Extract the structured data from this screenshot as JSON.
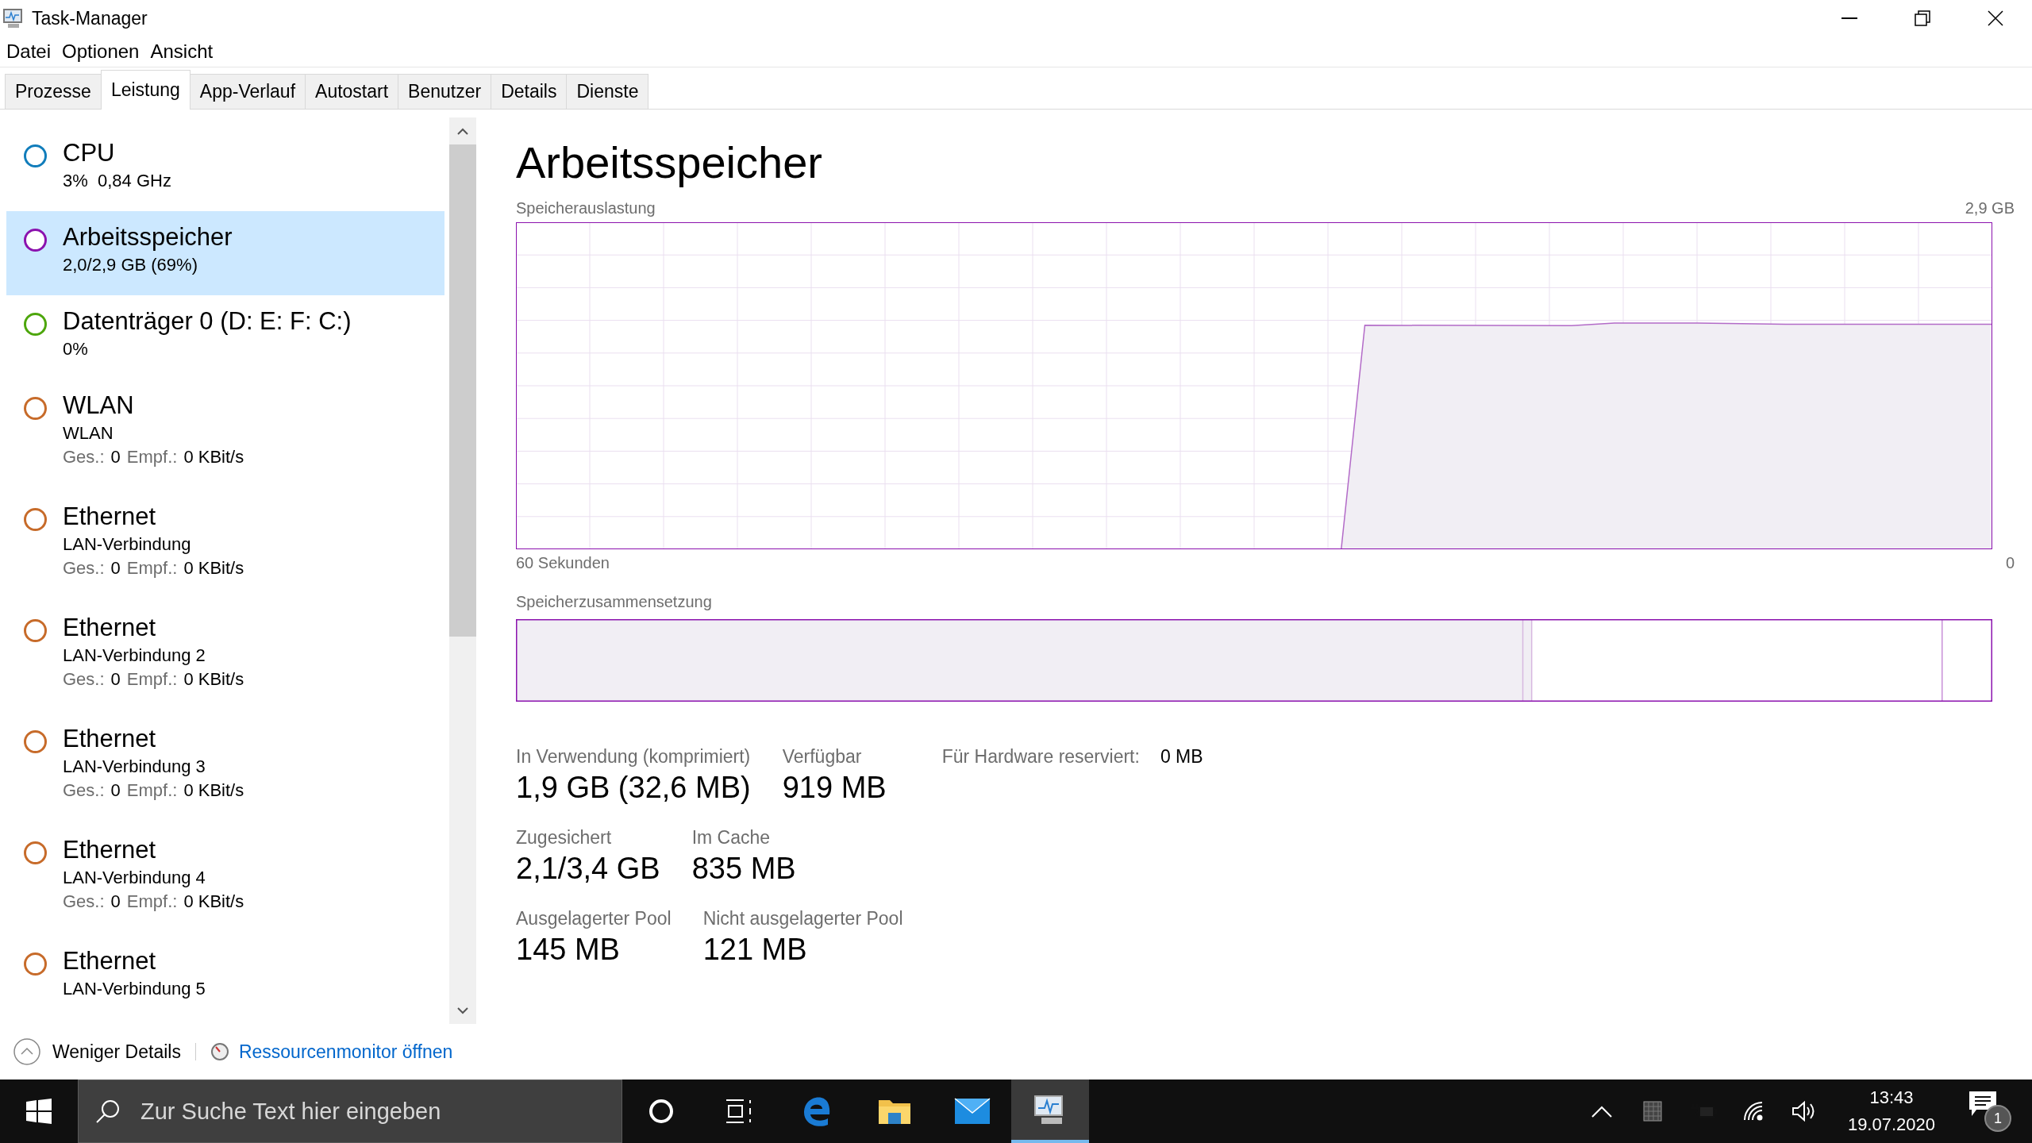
{
  "window": {
    "title": "Task-Manager"
  },
  "menu": [
    "Datei",
    "Optionen",
    "Ansicht"
  ],
  "tabs": [
    {
      "label": "Prozesse",
      "selected": false
    },
    {
      "label": "Leistung",
      "selected": true
    },
    {
      "label": "App-Verlauf",
      "selected": false
    },
    {
      "label": "Autostart",
      "selected": false
    },
    {
      "label": "Benutzer",
      "selected": false
    },
    {
      "label": "Details",
      "selected": false
    },
    {
      "label": "Dienste",
      "selected": false
    }
  ],
  "sidebar": {
    "items": [
      {
        "title": "CPU",
        "subtitle": "3%  0,84 GHz",
        "color": "#117dbb",
        "selected": false
      },
      {
        "title": "Arbeitsspeicher",
        "subtitle": "2,0/2,9 GB (69%)",
        "color": "#8b12ae",
        "selected": true
      },
      {
        "title": "Datenträger 0 (D: E: F: C:)",
        "subtitle": "0%",
        "color": "#4da60c",
        "selected": false
      },
      {
        "title": "WLAN",
        "subtitle": "WLAN",
        "rates": [
          {
            "label": "Ges.:",
            "value": "0"
          },
          {
            "label": "Empf.:",
            "value": "0 KBit/s"
          }
        ],
        "color": "#c76b2a",
        "selected": false
      },
      {
        "title": "Ethernet",
        "subtitle": "LAN-Verbindung",
        "rates": [
          {
            "label": "Ges.:",
            "value": "0"
          },
          {
            "label": "Empf.:",
            "value": "0 KBit/s"
          }
        ],
        "color": "#c76b2a",
        "selected": false
      },
      {
        "title": "Ethernet",
        "subtitle": "LAN-Verbindung 2",
        "rates": [
          {
            "label": "Ges.:",
            "value": "0"
          },
          {
            "label": "Empf.:",
            "value": "0 KBit/s"
          }
        ],
        "color": "#c76b2a",
        "selected": false
      },
      {
        "title": "Ethernet",
        "subtitle": "LAN-Verbindung 3",
        "rates": [
          {
            "label": "Ges.:",
            "value": "0"
          },
          {
            "label": "Empf.:",
            "value": "0 KBit/s"
          }
        ],
        "color": "#c76b2a",
        "selected": false
      },
      {
        "title": "Ethernet",
        "subtitle": "LAN-Verbindung 4",
        "rates": [
          {
            "label": "Ges.:",
            "value": "0"
          },
          {
            "label": "Empf.:",
            "value": "0 KBit/s"
          }
        ],
        "color": "#c76b2a",
        "selected": false
      },
      {
        "title": "Ethernet",
        "subtitle": "LAN-Verbindung 5",
        "color": "#c76b2a",
        "selected": false
      }
    ]
  },
  "detail": {
    "title": "Arbeitsspeicher",
    "usage_label": "Speicherauslastung",
    "usage_max": "2,9 GB",
    "time_label": "60 Sekunden",
    "time_end": "0",
    "composition_label": "Speicherzusammensetzung",
    "stat_rows": [
      [
        {
          "label": "In Verwendung (komprimiert)",
          "value": "1,9 GB (32,6 MB)"
        },
        {
          "label": "Verfügbar",
          "value": "919 MB"
        }
      ],
      [
        {
          "label": "Zugesichert",
          "value": "2,1/3,4 GB"
        },
        {
          "label": "Im Cache",
          "value": "835 MB"
        }
      ],
      [
        {
          "label": "Ausgelagerter Pool",
          "value": "145 MB"
        },
        {
          "label": "Nicht ausgelagerter Pool",
          "value": "121 MB"
        }
      ]
    ],
    "reserved": {
      "label": "Für Hardware reserviert:",
      "value": "0 MB"
    }
  },
  "footer": {
    "less_details": "Weniger Details",
    "resource_monitor": "Ressourcenmonitor öffnen"
  },
  "taskbar": {
    "search": {
      "placeholder": "Zur Suche Text hier eingeben"
    },
    "time": "13:43",
    "date": "19.07.2020",
    "notifications": "1"
  }
}
